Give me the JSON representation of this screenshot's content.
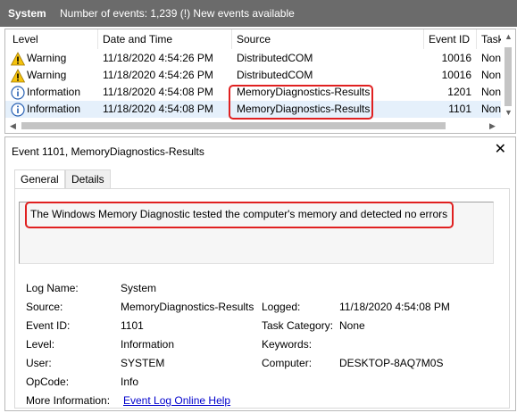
{
  "header": {
    "title": "System",
    "info": "Number of events: 1,239 (!) New events available"
  },
  "columns": [
    "Level",
    "Date and Time",
    "Source",
    "Event ID",
    "Task"
  ],
  "rows": [
    {
      "level": "Warning",
      "icon": "warning-icon",
      "date": "11/18/2020 4:54:26 PM",
      "source": "DistributedCOM",
      "event_id": "10016",
      "task": "None"
    },
    {
      "level": "Warning",
      "icon": "warning-icon",
      "date": "11/18/2020 4:54:26 PM",
      "source": "DistributedCOM",
      "event_id": "10016",
      "task": "None"
    },
    {
      "level": "Information",
      "icon": "info-icon",
      "date": "11/18/2020 4:54:08 PM",
      "source": "MemoryDiagnostics-Results",
      "event_id": "1201",
      "task": "None"
    },
    {
      "level": "Information",
      "icon": "info-icon",
      "date": "11/18/2020 4:54:08 PM",
      "source": "MemoryDiagnostics-Results",
      "event_id": "1101",
      "task": "None"
    }
  ],
  "details": {
    "title": "Event 1101, MemoryDiagnostics-Results",
    "tabs": [
      "General",
      "Details"
    ],
    "description": "The Windows Memory Diagnostic tested the computer's memory and detected no errors",
    "labels": {
      "log_name": "Log Name:",
      "source": "Source:",
      "event_id": "Event ID:",
      "level": "Level:",
      "user": "User:",
      "opcode": "OpCode:",
      "more_info": "More Information:",
      "logged": "Logged:",
      "task_category": "Task Category:",
      "keywords": "Keywords:",
      "computer": "Computer:"
    },
    "values": {
      "log_name": "System",
      "source": "MemoryDiagnostics-Results",
      "event_id": "1101",
      "level": "Information",
      "user": "SYSTEM",
      "opcode": "Info",
      "more_info": "Event Log Online Help",
      "logged": "11/18/2020 4:54:08 PM",
      "task_category": "None",
      "keywords": "",
      "computer": "DESKTOP-8AQ7M0S"
    }
  },
  "colors": {
    "header_bg": "#6b6b6b",
    "highlight": "#e02020",
    "link": "#0000cc",
    "selected_row": "#e5f0fb"
  }
}
